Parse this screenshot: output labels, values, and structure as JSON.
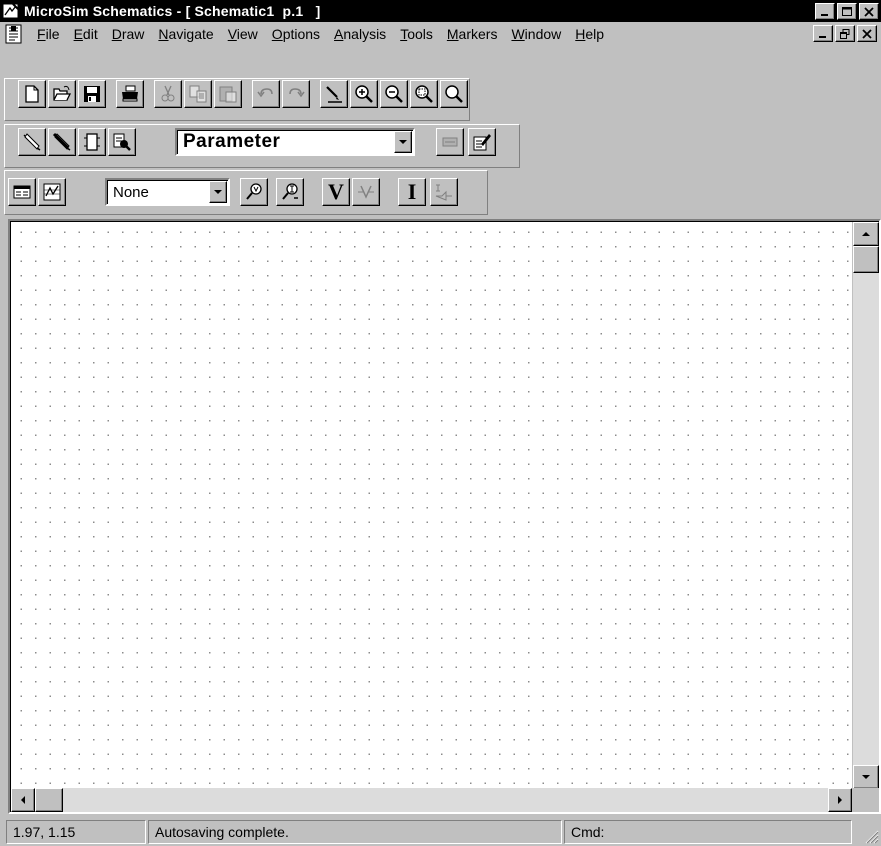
{
  "window": {
    "title": "MicroSim Schematics - [ Schematic1  p.1   ]",
    "controls": [
      "minimize-icon",
      "maximize-icon",
      "close-icon"
    ]
  },
  "menubar": {
    "items": [
      {
        "label": "File",
        "accel": "F"
      },
      {
        "label": "Edit",
        "accel": "E"
      },
      {
        "label": "Draw",
        "accel": "D"
      },
      {
        "label": "Navigate",
        "accel": "N"
      },
      {
        "label": "View",
        "accel": "V"
      },
      {
        "label": "Options",
        "accel": "O"
      },
      {
        "label": "Analysis",
        "accel": "A"
      },
      {
        "label": "Tools",
        "accel": "T"
      },
      {
        "label": "Markers",
        "accel": "M"
      },
      {
        "label": "Window",
        "accel": "W"
      },
      {
        "label": "Help",
        "accel": "H"
      }
    ]
  },
  "toolbar1": {
    "buttons": [
      "new-icon",
      "open-icon",
      "save-icon",
      "print-icon",
      "cut-icon",
      "copy-icon",
      "paste-icon",
      "undo-icon",
      "redo-icon",
      "redraw-icon",
      "zoom-in-icon",
      "zoom-out-icon",
      "zoom-area-icon",
      "zoom-fit-icon"
    ]
  },
  "toolbar2": {
    "buttons": [
      "draw-wire-icon",
      "draw-bus-icon",
      "draw-block-icon",
      "get-part-icon",
      "edit-attributes-icon",
      "edit-symbol-icon"
    ],
    "part_combo": {
      "value": "Parameter"
    }
  },
  "toolbar3": {
    "buttons": [
      "setup-analysis-icon",
      "simulate-icon",
      "enable-bias-voltage-icon",
      "enable-bias-current-icon",
      "show-voltage-icon",
      "show-selected-voltage-icon",
      "show-current-icon",
      "show-selected-current-icon"
    ],
    "marker_combo": {
      "value": "None"
    },
    "v_label": "V",
    "i_label": "I"
  },
  "statusbar": {
    "coords": "1.97,  1.15",
    "message": "Autosaving complete.",
    "cmd": "Cmd:"
  },
  "colors": {
    "face": "#c0c0c0",
    "titlebar": "#000000",
    "canvas": "#ffffff",
    "grid_dot": "#8a8a8a"
  }
}
